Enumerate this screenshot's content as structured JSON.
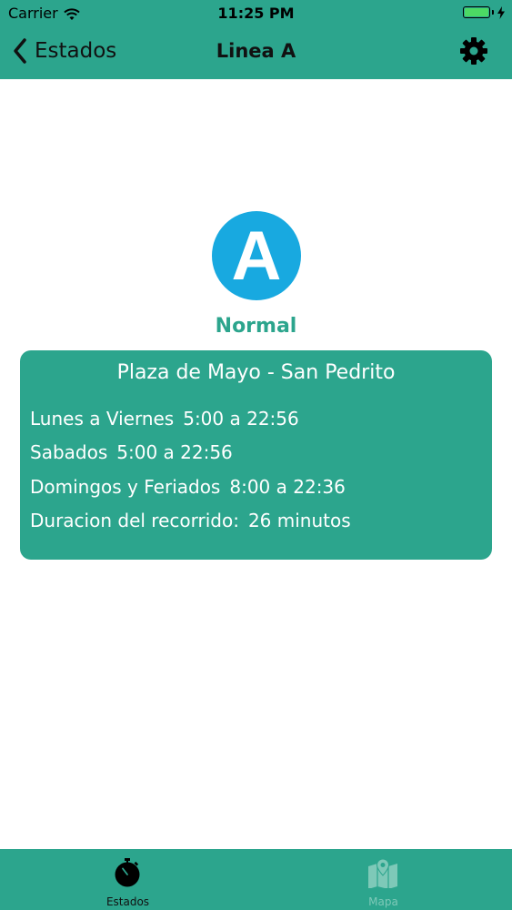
{
  "status_bar": {
    "carrier": "Carrier",
    "time": "11:25 PM",
    "battery_level": 1.0
  },
  "nav": {
    "back_label": "Estados",
    "title": "Linea A",
    "settings_icon": "gear-icon"
  },
  "line": {
    "letter": "A",
    "status": "Normal",
    "badge_color": "#18a9e0"
  },
  "card": {
    "route": "Plaza de Mayo - San Pedrito",
    "rows": [
      {
        "label": "Lunes a Viernes",
        "value": "5:00 a 22:56"
      },
      {
        "label": "Sabados",
        "value": "5:00 a 22:56"
      },
      {
        "label": "Domingos y Feriados",
        "value": "8:00 a 22:36"
      },
      {
        "label": "Duracion del recorrido:",
        "value": "26 minutos"
      }
    ]
  },
  "tabs": [
    {
      "label": "Estados",
      "icon": "stopwatch-icon",
      "selected": true
    },
    {
      "label": "Mapa",
      "icon": "map-icon",
      "selected": false
    }
  ],
  "colors": {
    "brand": "#2ca58d",
    "tab_inactive": "#7ec9b8"
  }
}
